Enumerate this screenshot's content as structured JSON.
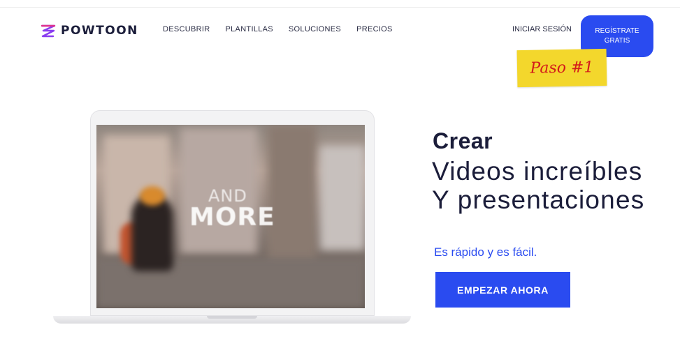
{
  "header": {
    "logo_text": "POWTOON",
    "nav": [
      "DESCUBRIR",
      "PLANTILLAS",
      "SOLUCIONES",
      "PRECIOS"
    ],
    "login_label": "INICIAR SESIÓN",
    "signup_line1": "REGÍSTRATE",
    "signup_line2": "GRATIS"
  },
  "annotation": {
    "note_text": "Paso #1",
    "note_color": "#f3d72c",
    "text_color": "#d31b1b"
  },
  "video": {
    "overlay_small": "AND",
    "overlay_big": "MORE"
  },
  "hero": {
    "title_bold": "Crear",
    "title_line1": "Videos increíbles",
    "title_line2": "Y presentaciones",
    "tagline": "Es rápido y es fácil.",
    "cta_label": "EMPEZAR AHORA"
  },
  "colors": {
    "accent": "#2a4bf0",
    "text": "#1b1d3a"
  }
}
